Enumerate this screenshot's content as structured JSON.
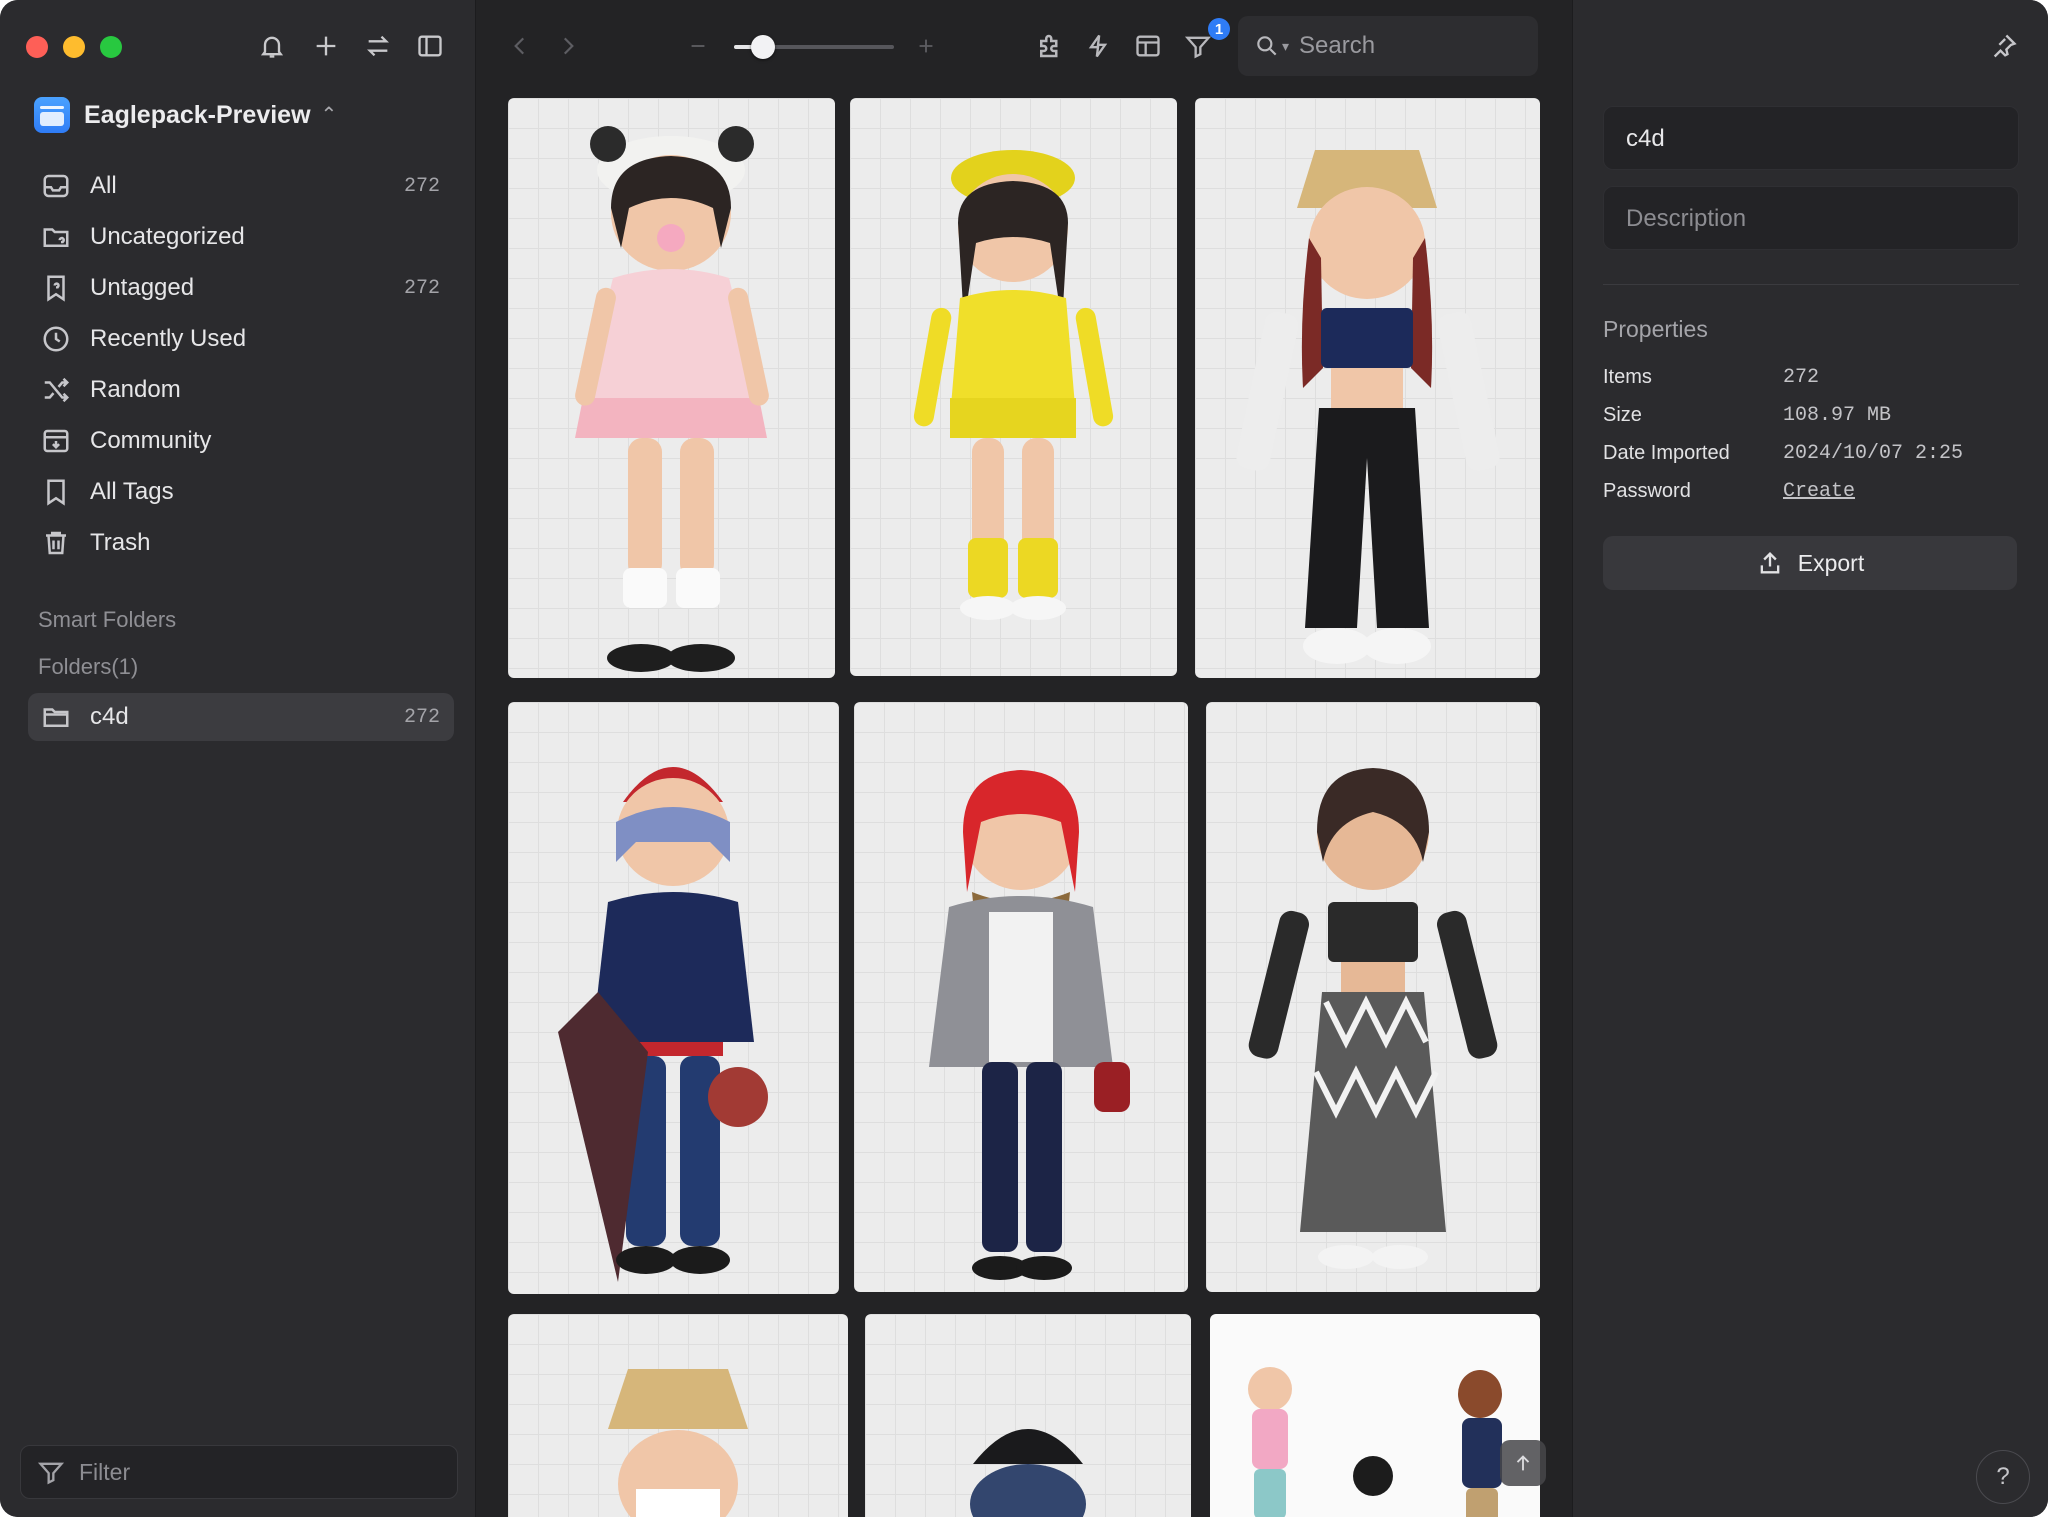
{
  "library": {
    "name": "Eaglepack-Preview"
  },
  "sidebar": {
    "items": [
      {
        "label": "All",
        "count": "272",
        "icon": "inbox-icon"
      },
      {
        "label": "Uncategorized",
        "count": "",
        "icon": "uncategorized-folder-icon"
      },
      {
        "label": "Untagged",
        "count": "272",
        "icon": "untagged-icon"
      },
      {
        "label": "Recently Used",
        "count": "",
        "icon": "clock-icon"
      },
      {
        "label": "Random",
        "count": "",
        "icon": "shuffle-icon"
      },
      {
        "label": "Community",
        "count": "",
        "icon": "download-box-icon"
      },
      {
        "label": "All Tags",
        "count": "",
        "icon": "bookmark-icon"
      },
      {
        "label": "Trash",
        "count": "",
        "icon": "trash-icon"
      }
    ],
    "smart_folders_title": "Smart Folders",
    "folders_title": "Folders(1)",
    "folders": [
      {
        "label": "c4d",
        "count": "272"
      }
    ],
    "filter_placeholder": "Filter"
  },
  "toolbar": {
    "zoom_level": 0.18,
    "filter_badge": "1",
    "search_placeholder": "Search"
  },
  "inspector": {
    "name_value": "c4d",
    "description_placeholder": "Description",
    "properties_title": "Properties",
    "properties": [
      {
        "key": "Items",
        "value": "272"
      },
      {
        "key": "Size",
        "value": "108.97 MB"
      },
      {
        "key": "Date Imported",
        "value": "2024/10/07 2:25"
      },
      {
        "key": "Password",
        "value": "Create"
      }
    ],
    "export_label": "Export",
    "help_label": "?"
  },
  "grid": {
    "items": [
      {
        "desc": "character-girl-pink-dress-white-beret"
      },
      {
        "desc": "character-girl-yellow-plaid"
      },
      {
        "desc": "character-girl-bucket-hat-black-pants"
      },
      {
        "desc": "character-boy-red-cap-umbrella"
      },
      {
        "desc": "character-girl-red-hair-grey-blazer"
      },
      {
        "desc": "character-girl-black-top-zebra-skirt"
      },
      {
        "desc": "character-girl-bucket-hat-mask"
      },
      {
        "desc": "character-back-black-cap"
      },
      {
        "desc": "character-group-three"
      }
    ]
  },
  "colors": {
    "accent": "#2f7cf6",
    "sidebar_bg": "#2b2b2e",
    "content_bg": "#232325"
  }
}
